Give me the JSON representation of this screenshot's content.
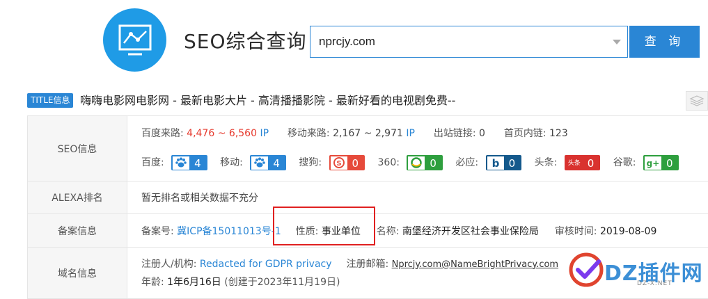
{
  "header": {
    "site_title": "SEO综合查询",
    "search_value": "nprcjy.com",
    "search_button": "查 询"
  },
  "title_bar": {
    "badge": "TITLE信息",
    "text": "嗨嗨电影网电影网 - 最新电影大片 - 高清播播影院 - 最新好看的电视剧免费--"
  },
  "seo": {
    "label": "SEO信息",
    "baidu_traffic_label": "百度来路:",
    "baidu_traffic_low": "4,476",
    "baidu_traffic_sep": "~",
    "baidu_traffic_high": "6,560",
    "baidu_traffic_ip": "IP",
    "mobile_traffic_label": "移动来路:",
    "mobile_traffic_value": "2,167 ~ 2,971",
    "mobile_traffic_ip": "IP",
    "outbound_label": "出站链接:",
    "outbound_value": "0",
    "inbound_label": "首页内链:",
    "inbound_value": "123",
    "engines": [
      {
        "name": "百度:",
        "value": "4",
        "icon": "baidu-paw-icon"
      },
      {
        "name": "移动:",
        "value": "4",
        "icon": "mobile-paw-icon"
      },
      {
        "name": "搜狗:",
        "value": "0",
        "icon": "sogou-icon"
      },
      {
        "name": "360:",
        "value": "0",
        "icon": "so360-icon"
      },
      {
        "name": "必应:",
        "value": "0",
        "icon": "bing-icon"
      },
      {
        "name": "头条:",
        "value": "0",
        "icon": "toutiao-icon",
        "icon_text": "头条"
      },
      {
        "name": "谷歌:",
        "value": "0",
        "icon": "google-plus-icon",
        "icon_text": "g+"
      }
    ]
  },
  "alexa": {
    "label": "ALEXA排名",
    "value": "暂无排名或相关数据不充分"
  },
  "beian": {
    "label": "备案信息",
    "number_label": "备案号:",
    "number_value": "冀ICP备15011013号-1",
    "nature_label": "性质:",
    "nature_value": "事业单位",
    "name_label": "名称:",
    "name_value": "南堡经济开发区社会事业保险局",
    "audit_label": "审核时间:",
    "audit_value": "2019-08-09"
  },
  "domain": {
    "label": "域名信息",
    "registrant_label": "注册人/机构:",
    "registrant_value": "Redacted for GDPR privacy",
    "email_label": "注册邮箱:",
    "email_value": "Nprcjy.com@NameBrightPrivacy.com",
    "age_label": "年龄:",
    "age_value": "1年6月16日",
    "created": "(创建于2023年11月19日)"
  },
  "watermark": {
    "text": "DZ插件网",
    "sub": "DZ-X.NET"
  },
  "colors": {
    "accent": "#2a86d5",
    "logo": "#1f9be6",
    "red": "#e63a2e",
    "highlight": "#e02020"
  }
}
